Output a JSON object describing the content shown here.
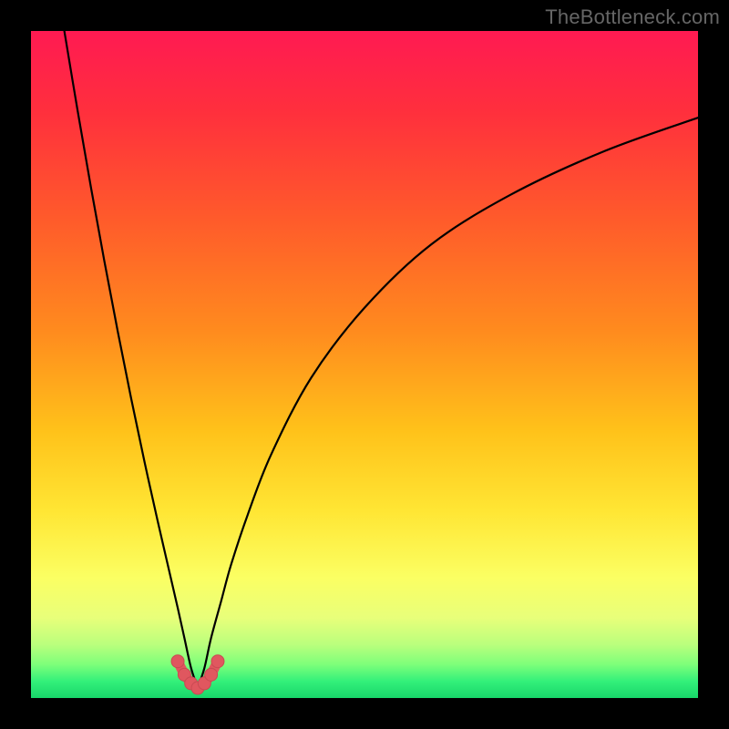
{
  "watermark": "TheBottleneck.com",
  "colors": {
    "gradient_stops": [
      {
        "offset": 0.0,
        "color": "#ff1a52"
      },
      {
        "offset": 0.12,
        "color": "#ff2f3d"
      },
      {
        "offset": 0.28,
        "color": "#ff5a2b"
      },
      {
        "offset": 0.45,
        "color": "#ff8b1e"
      },
      {
        "offset": 0.6,
        "color": "#ffc21a"
      },
      {
        "offset": 0.72,
        "color": "#ffe634"
      },
      {
        "offset": 0.82,
        "color": "#fbff63"
      },
      {
        "offset": 0.88,
        "color": "#e8ff7a"
      },
      {
        "offset": 0.92,
        "color": "#baff7d"
      },
      {
        "offset": 0.95,
        "color": "#7dff7a"
      },
      {
        "offset": 0.975,
        "color": "#33f07a"
      },
      {
        "offset": 1.0,
        "color": "#18d66a"
      }
    ],
    "curve": "#000000",
    "markers_fill": "#e0575f",
    "markers_stroke": "#c94a52",
    "frame": "#000000"
  },
  "chart_data": {
    "type": "line",
    "title": "",
    "xlabel": "",
    "ylabel": "",
    "xlim": [
      0,
      100
    ],
    "ylim": [
      0,
      100
    ],
    "x_optimum": 25,
    "series": [
      {
        "name": "left-branch",
        "x": [
          5.0,
          7.0,
          9.0,
          11.0,
          13.0,
          15.0,
          17.0,
          19.0,
          20.5,
          22.0,
          23.0,
          24.0,
          25.0
        ],
        "y": [
          100,
          88.0,
          76.5,
          65.5,
          55.0,
          45.0,
          35.5,
          26.5,
          20.0,
          13.5,
          9.0,
          4.5,
          1.5
        ]
      },
      {
        "name": "right-branch",
        "x": [
          25.0,
          26.0,
          27.0,
          28.5,
          30.0,
          32.5,
          36.0,
          42.0,
          50.0,
          60.0,
          72.0,
          86.0,
          100.0
        ],
        "y": [
          1.5,
          4.5,
          9.0,
          14.5,
          20.0,
          27.5,
          36.5,
          48.0,
          58.5,
          68.0,
          75.5,
          82.0,
          87.0
        ]
      }
    ],
    "markers": {
      "name": "optimum-cluster",
      "x": [
        22.0,
        23.0,
        24.0,
        25.0,
        26.0,
        27.0,
        28.0
      ],
      "y": [
        5.5,
        3.5,
        2.2,
        1.5,
        2.2,
        3.5,
        5.5
      ]
    }
  }
}
